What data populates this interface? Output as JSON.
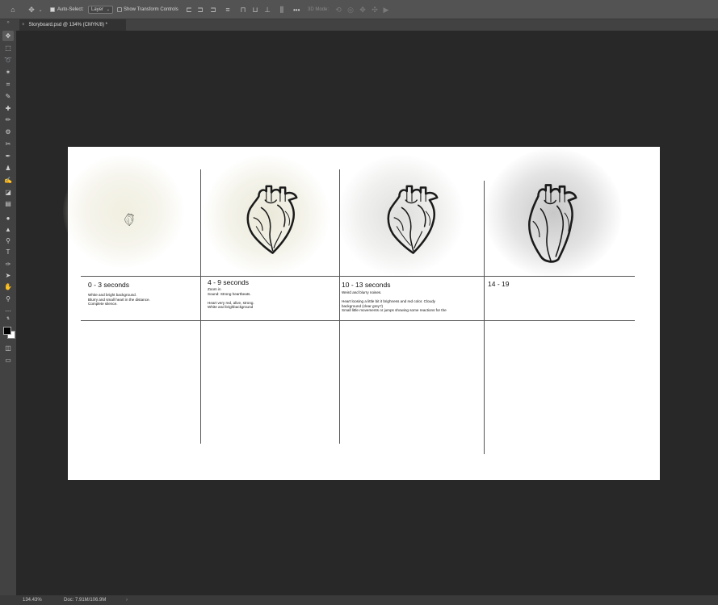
{
  "options_bar": {
    "auto_select_label": "Auto-Select:",
    "layer_dropdown": "Layer",
    "transform_controls_label": "Show Transform Controls",
    "more_label": "•••",
    "mode_3d_label": "3D Mode:"
  },
  "document_tab": {
    "title": "Storyboard.psd @ 134% (CMYK/8) *"
  },
  "storyboard": {
    "frames": [
      {
        "heading": "0 - 3 seconds",
        "notes": "White and bright background.\nBlurry and small heart in the distance.\nComplete silence."
      },
      {
        "heading": "4 - 9 seconds",
        "notes": "Zoom in\nSound: Strong heartbeats.\n\nHeart very red, alive, strong.\nWhite and brighbackground"
      },
      {
        "heading": "10 - 13 seconds",
        "notes": "Weird and blurry noises.\n\nHeart loosing a little bit it brighness and red color. Cloudy\nbackground (clear grey?)\nSmall little movements or jumps showing some reactions for the"
      },
      {
        "heading": "14 - 19",
        "notes": ""
      }
    ]
  },
  "status_bar": {
    "zoom": "134.43%",
    "doc_size": "Doc: 7.91M/106.9M",
    "arrow": "›"
  },
  "colors": {
    "app_background": "#282828",
    "panel": "#424242",
    "options_bar": "#535353",
    "canvas": "#ffffff",
    "foreground_color": "#000000",
    "background_color": "#ffffff"
  }
}
